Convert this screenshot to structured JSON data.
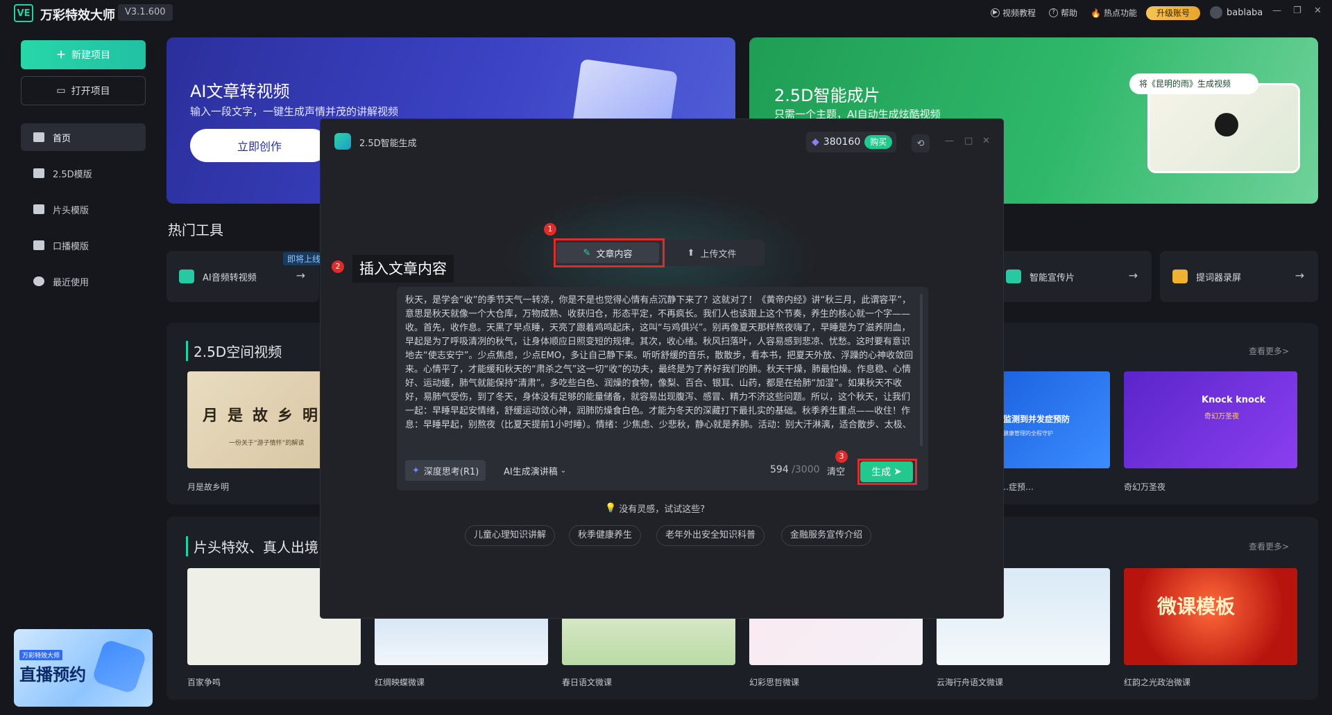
{
  "app": {
    "logo": "VE",
    "name": "万彩特效大师",
    "version": "V3.1.600",
    "top_links": [
      "视频教程",
      "帮助",
      "热点功能"
    ],
    "upgrade": "升级账号",
    "username": "bablaba",
    "window_controls": [
      "—",
      "❐",
      "✕"
    ]
  },
  "sidebar": {
    "new_project": "新建项目",
    "open_project": "打开项目",
    "items": [
      {
        "label": "首页"
      },
      {
        "label": "2.5D模版"
      },
      {
        "label": "片头模版"
      },
      {
        "label": "口播模版"
      },
      {
        "label": "最近使用"
      }
    ],
    "live_banner": {
      "tag": "万彩特效大师",
      "text": "直播预约"
    }
  },
  "banners": {
    "ai": {
      "title": "AI文章转视频",
      "subtitle": "输入一段文字，一键生成声情并茂的讲解视频",
      "button": "立即创作"
    },
    "d25": {
      "title": "2.5D智能成片",
      "subtitle": "只需一个主题，AI自动生成炫酷视频",
      "pill": "将《昆明的雨》生成视频"
    }
  },
  "hot_tools": {
    "title": "热门工具",
    "soon_badge": "即将上线",
    "items": [
      {
        "label": "AI音频转视频"
      },
      {
        "label": "智能宣传片"
      },
      {
        "label": "提词器录屏"
      }
    ]
  },
  "section_25d": {
    "title": "2.5D空间视频",
    "more": "查看更多>",
    "items": [
      {
        "caption": "月是故乡明",
        "thumb_text": "月是故乡明",
        "thumb_sub": "一份关于“游子情怀”的解读"
      },
      {
        "caption": "…症预…",
        "thumb_text": "监测到并发症预防",
        "thumb_sub": "健康管理的全程守护"
      },
      {
        "caption": "奇幻万圣夜",
        "thumb_text": "Knock knock",
        "thumb_sub": "奇幻万圣夜"
      }
    ]
  },
  "section_intro": {
    "title": "片头特效、真人出境",
    "more": "查看更多>",
    "items": [
      {
        "caption": "百家争鸣"
      },
      {
        "caption": "红绸映蝶微课"
      },
      {
        "caption": "春日语文微课"
      },
      {
        "caption": "幻彩思哲微课"
      },
      {
        "caption": "云海行舟语文微课"
      },
      {
        "caption": "红韵之光政治微课",
        "thumb_text": "微课模板"
      }
    ]
  },
  "modal": {
    "title": "2.5D智能生成",
    "credits": "380160",
    "buy": "购买",
    "tabs": {
      "article": "文章内容",
      "upload": "上传文件"
    },
    "annotation_2": "插入文章内容",
    "markers": [
      "1",
      "2",
      "3"
    ],
    "editor_text": "秋天，是学会“收”的季节天气一转凉，你是不是也觉得心情有点沉静下来了？这就对了！《黄帝内经》讲“秋三月，此谓容平”，意思是秋天就像一个大仓库，万物成熟、收获归仓，形态平定，不再疯长。我们人也该跟上这个节奏，养生的核心就一个字——收。首先，收作息。天黑了早点睡，天亮了跟着鸡鸣起床，这叫“与鸡俱兴”。别再像夏天那样熬夜嗨了，早睡是为了滋养阴血，早起是为了呼吸清冽的秋气，让身体顺应日照变短的规律。其次，收心绪。秋风扫落叶，人容易感到悲凉、忧愁。这时要有意识地去“使志安宁”。少点焦虑，少点EMO，多让自己静下来。听听舒缓的音乐，散散步，看本书，把夏天外放、浮躁的心神收敛回来。心情平了，才能缓和秋天的“肃杀之气”这一切“收”的功夫，最终是为了养好我们的肺。秋天干燥，肺最怕燥。作息稳、心情好、运动缓，肺气就能保持“清肃”。多吃些白色、润燥的食物，像梨、百合、银耳、山药，都是在给肺“加湿”。如果秋天不收好，易肺气受伤，到了冬天，身体没有足够的能量储备，就容易出现腹泻、感冒、精力不济这些问题。所以，这个秋天，让我们一起：早睡早起安情绪，舒缓运动敛心神，润肺防燥食白色。才能为冬天的深藏打下最扎实的基础。秋季养生重点——收住！作息：早睡早起，别熬夜（比夏天提前1小时睡）。情绪：少焦虑、少悲秋，静心就是养肺。活动：别大汗淋漓，适合散步、太极、",
    "deep_think": "深度思考(R1)",
    "ai_script": "AI生成演讲稿",
    "char_count": "594",
    "char_max": "/3000",
    "clear": "清空",
    "generate": "生成",
    "no_idea": "没有灵感，试试这些?",
    "suggestions": [
      "儿童心理知识讲解",
      "秋季健康养生",
      "老年外出安全知识科普",
      "金融服务宣传介绍"
    ]
  }
}
